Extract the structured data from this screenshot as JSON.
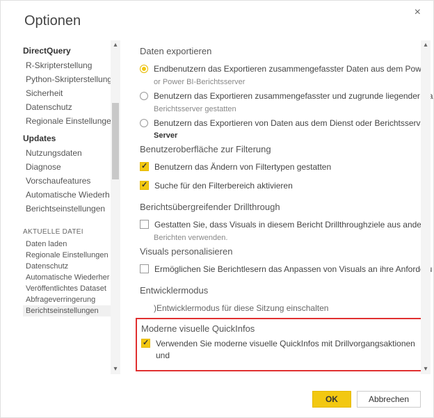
{
  "dialog": {
    "title": "Optionen",
    "close_label": "×"
  },
  "sidebar": {
    "group1": "DirectQuery",
    "items1": [
      "R-Skripterstellung",
      "Python-Skripterstellung",
      "Sicherheit",
      "Datenschutz",
      "Regionale Einstellungen"
    ],
    "group2": "Updates",
    "items2": [
      "Nutzungsdaten",
      "Diagnose",
      "Vorschaufeatures",
      "Automatische Wiederherstellung",
      "Berichtseinstellungen"
    ],
    "group3": "AKTUELLE DATEI",
    "items3": [
      "Daten laden",
      "Regionale Einstellungen",
      "Datenschutz",
      "Automatische Wiederherstellung",
      "Veröffentlichtes Dataset",
      "Abfrageverringerung",
      "Berichtseinstellungen"
    ]
  },
  "content": {
    "export": {
      "title": "Daten exportieren",
      "opt1": "Endbenutzern das Exportieren zusammengefasster Daten aus dem Power",
      "opt1_sub": "or Power BI-Berichtsserver",
      "opt2": "Benutzern das Exportieren zusammengefasster und zugrunde liegender Da",
      "opt2_sub": "Berichtsserver gestatten",
      "opt3": "Benutzern das Exportieren von Daten aus dem Dienst oder Berichtsserver",
      "opt3_sub": "Server"
    },
    "filter_ui": {
      "title": "Benutzeroberfläche zur Filterung",
      "chk1": "Benutzern das Ändern von Filtertypen gestatten",
      "chk2": "Suche für den Filterbereich aktivieren"
    },
    "drill": {
      "title": "Berichtsübergreifender Drillthrough",
      "chk1": "Gestatten Sie, dass Visuals in diesem Bericht Drillthroughziele aus andere",
      "sub": "Berichten verwenden."
    },
    "personalize": {
      "title": "Visuals personalisieren",
      "chk1": "Ermöglichen Sie Berichtlesern das Anpassen von Visuals an ihre Anforderu"
    },
    "devmode": {
      "title": "Entwicklermodus",
      "chk1": ")Entwicklermodus für diese Sitzung einschalten"
    },
    "tooltips": {
      "title": "Moderne visuelle QuickInfos",
      "chk1": "Verwenden Sie moderne visuelle QuickInfos mit Drillvorgangsaktionen und"
    }
  },
  "footer": {
    "ok": "OK",
    "cancel": "Abbrechen"
  }
}
